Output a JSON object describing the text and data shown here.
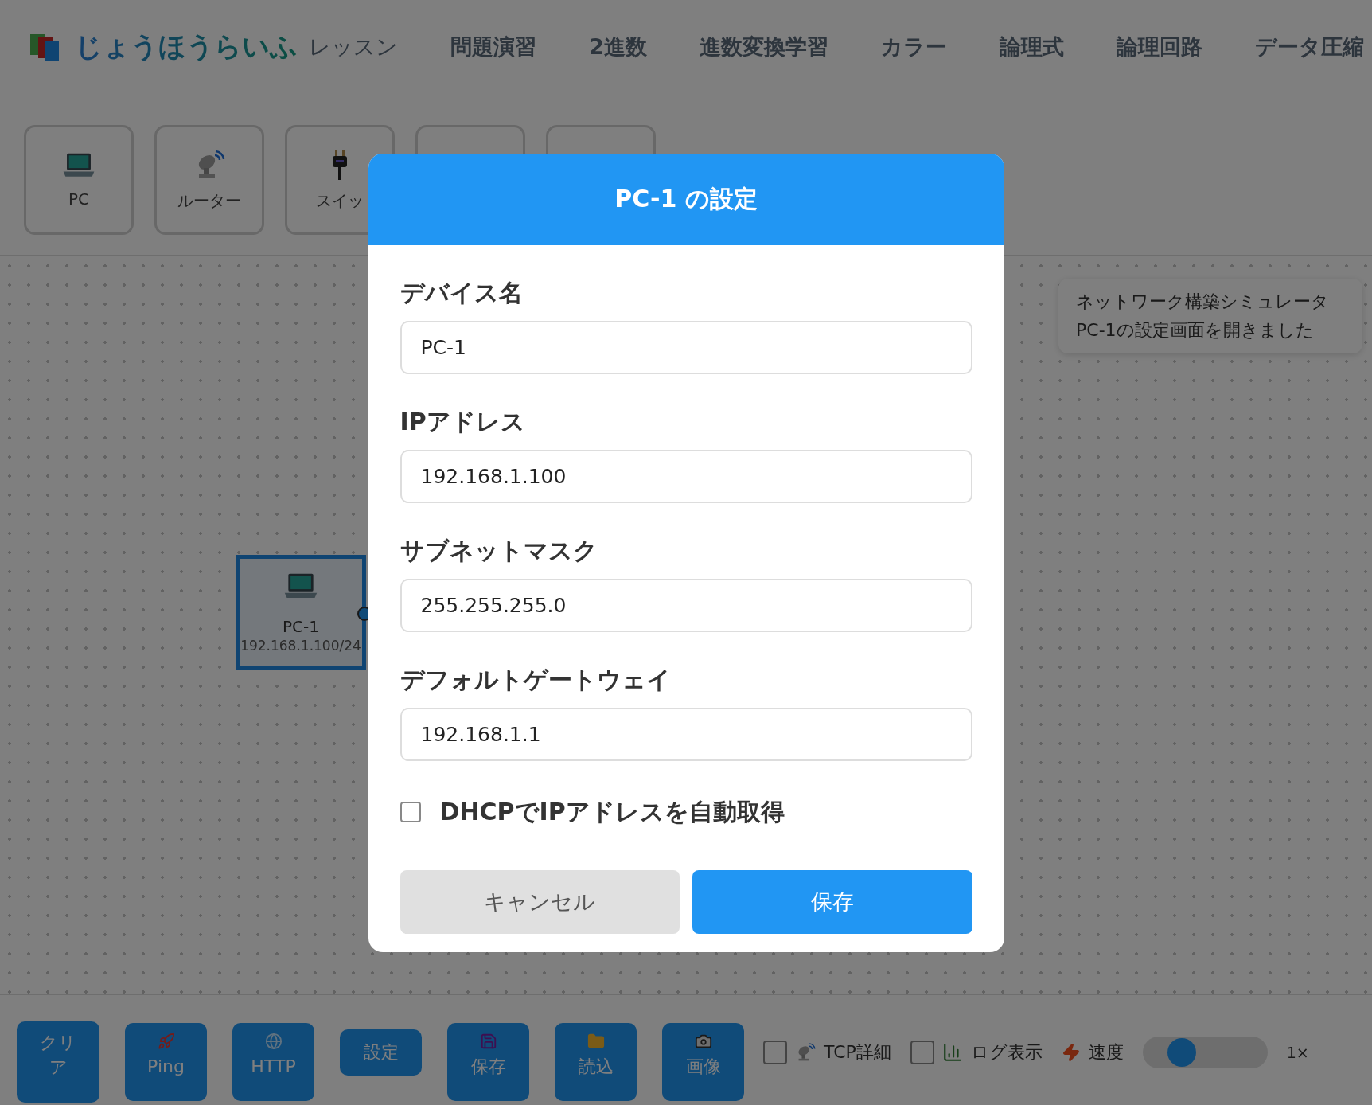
{
  "header": {
    "logo_text": "じょうほうらいふ",
    "logo_suffix": "レッスン",
    "nav": [
      "問題演習",
      "2進数",
      "進数変換学習",
      "カラー",
      "論理式",
      "論理回路",
      "データ圧縮"
    ]
  },
  "palette": [
    {
      "label": "PC",
      "kind": "laptop"
    },
    {
      "label": "ルーター",
      "kind": "dish"
    },
    {
      "label": "スイッ",
      "kind": "plug"
    },
    {
      "kind": "blank"
    },
    {
      "kind": "blank"
    }
  ],
  "canvas": {
    "nodes": [
      {
        "name": "PC-1",
        "address": "192.168.1.100/24",
        "selected": true
      }
    ]
  },
  "notice": {
    "lines": [
      "ネットワーク構築シミュレータ",
      "PC-1の設定画面を開きました"
    ]
  },
  "dialog": {
    "title": "PC-1 の設定",
    "fields": [
      {
        "label": "デバイス名",
        "value": "PC-1"
      },
      {
        "label": "IPアドレス",
        "value": "192.168.1.100"
      },
      {
        "label": "サブネットマスク",
        "value": "255.255.255.0"
      },
      {
        "label": "デフォルトゲートウェイ",
        "value": "192.168.1.1"
      }
    ],
    "dhcp": {
      "label": "DHCPでIPアドレスを自動取得",
      "checked": false
    },
    "buttons": [
      {
        "label": "キャンセル",
        "kind": "secondary"
      },
      {
        "label": "保存",
        "kind": "primary"
      }
    ]
  },
  "toolbar": {
    "buttons": [
      {
        "label": "クリア",
        "kind": "plain"
      },
      {
        "label": "Ping",
        "kind": "rocket"
      },
      {
        "label": "HTTP",
        "kind": "globe"
      },
      {
        "label": "設定",
        "kind": "plain"
      },
      {
        "label": "保存",
        "kind": "save"
      },
      {
        "label": "読込",
        "kind": "folder"
      },
      {
        "label": "画像",
        "kind": "camera"
      }
    ],
    "toggles": [
      {
        "label": "TCP詳細",
        "checked": false,
        "kind": "dish"
      },
      {
        "label": "ログ表示",
        "checked": false,
        "kind": "chart"
      }
    ],
    "speed": {
      "label": "速度",
      "level": 0.25,
      "reading": "1×"
    }
  }
}
